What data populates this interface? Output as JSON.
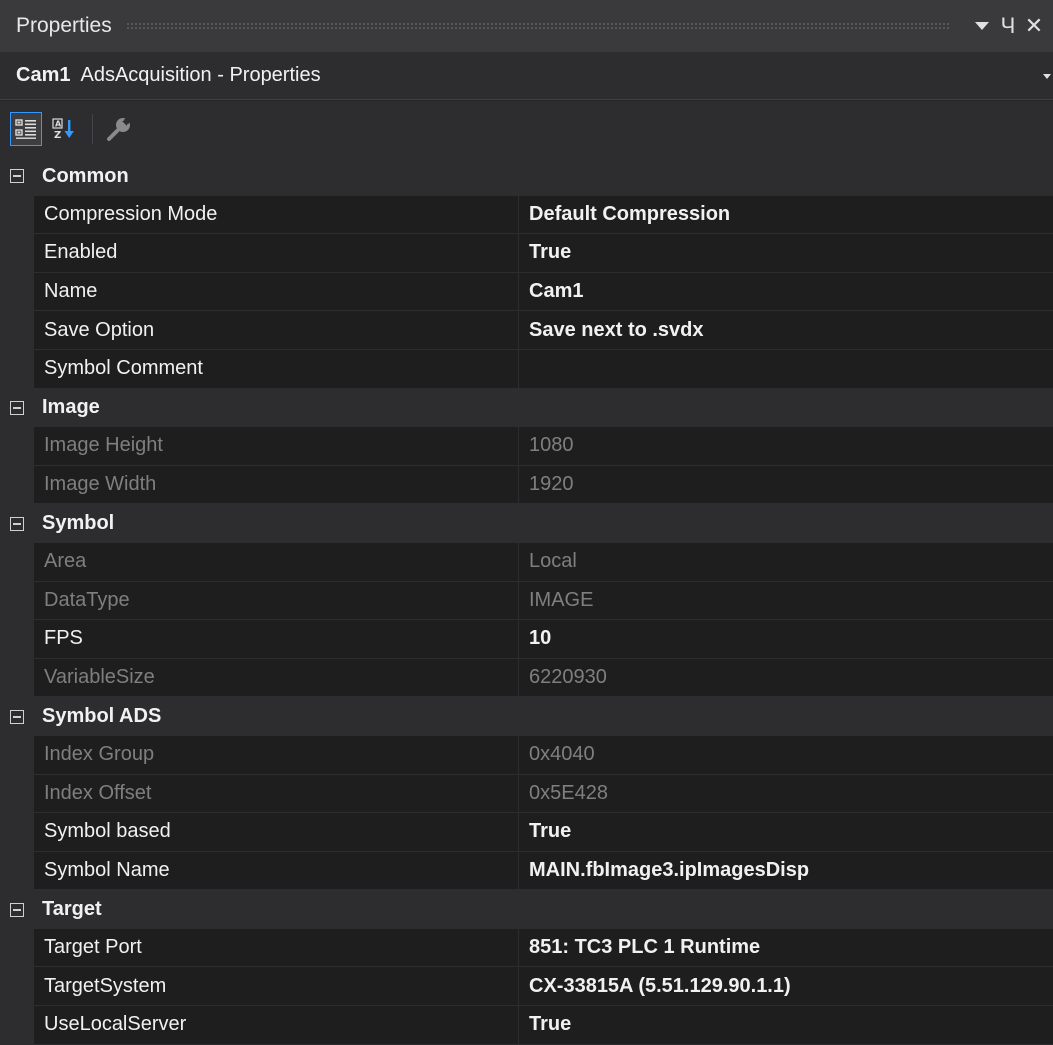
{
  "window": {
    "title": "Properties",
    "icons": {
      "menu": "chevron-down-icon",
      "pin": "pin-icon",
      "close": "close-icon"
    },
    "pin_glyph": "Ч",
    "close_glyph": "✕"
  },
  "selector": {
    "object_name": "Cam1",
    "object_type": "AdsAcquisition - Properties"
  },
  "toolbar": {
    "buttons": [
      {
        "name": "categorized-icon",
        "active": true
      },
      {
        "name": "alphabetical-icon",
        "active": false
      },
      {
        "name": "property-pages-icon",
        "active": false
      }
    ]
  },
  "colors": {
    "accent": "#3399ff",
    "background": "#252526",
    "grid_row": "#1e1e1e",
    "category": "#2d2d30",
    "readonly_text": "#7f7f7f",
    "text": "#f1f1f1"
  },
  "categories": [
    {
      "label": "Common",
      "rows": [
        {
          "name": "Compression Mode",
          "value": "Default Compression",
          "bold": true,
          "readonly": false
        },
        {
          "name": "Enabled",
          "value": "True",
          "bold": true,
          "readonly": false
        },
        {
          "name": "Name",
          "value": "Cam1",
          "bold": true,
          "readonly": false
        },
        {
          "name": "Save Option",
          "value": "Save next to .svdx",
          "bold": true,
          "readonly": false
        },
        {
          "name": "Symbol Comment",
          "value": "",
          "bold": false,
          "readonly": false
        }
      ]
    },
    {
      "label": "Image",
      "rows": [
        {
          "name": "Image Height",
          "value": "1080",
          "bold": false,
          "readonly": true
        },
        {
          "name": "Image Width",
          "value": "1920",
          "bold": false,
          "readonly": true
        }
      ]
    },
    {
      "label": "Symbol",
      "rows": [
        {
          "name": "Area",
          "value": "Local",
          "bold": false,
          "readonly": true
        },
        {
          "name": "DataType",
          "value": "IMAGE",
          "bold": false,
          "readonly": true
        },
        {
          "name": "FPS",
          "value": "10",
          "bold": true,
          "readonly": false
        },
        {
          "name": "VariableSize",
          "value": "6220930",
          "bold": false,
          "readonly": true
        }
      ]
    },
    {
      "label": "Symbol ADS",
      "rows": [
        {
          "name": "Index Group",
          "value": "0x4040",
          "bold": false,
          "readonly": true
        },
        {
          "name": "Index Offset",
          "value": "0x5E428",
          "bold": false,
          "readonly": true
        },
        {
          "name": "Symbol based",
          "value": "True",
          "bold": true,
          "readonly": false
        },
        {
          "name": "Symbol Name",
          "value": "MAIN.fbImage3.ipImagesDisp",
          "bold": true,
          "readonly": false
        }
      ]
    },
    {
      "label": "Target",
      "rows": [
        {
          "name": "Target Port",
          "value": "851: TC3 PLC 1 Runtime",
          "bold": true,
          "readonly": false
        },
        {
          "name": "TargetSystem",
          "value": "CX-33815A (5.51.129.90.1.1)",
          "bold": true,
          "readonly": false
        },
        {
          "name": "UseLocalServer",
          "value": "True",
          "bold": true,
          "readonly": false
        }
      ]
    }
  ]
}
